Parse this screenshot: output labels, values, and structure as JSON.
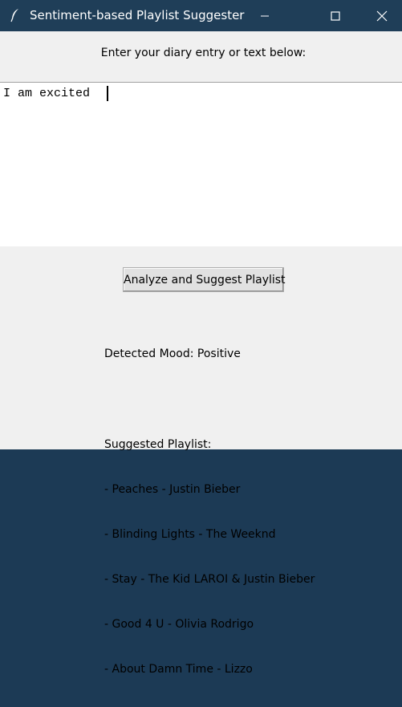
{
  "window": {
    "title": "Sentiment-based Playlist Suggester",
    "icon": "feather-icon"
  },
  "colors": {
    "titlebar_bg": "#1f3e58",
    "window_bg": "#f0f0f0",
    "text_area_bg": "#ffffff"
  },
  "prompt": {
    "label": "Enter your diary entry or text below:"
  },
  "text_area": {
    "value": "I am excited "
  },
  "actions": {
    "analyze_label": "Analyze and Suggest Playlist"
  },
  "result": {
    "mood_text": "Detected Mood: Positive",
    "playlist_heading": "Suggested Playlist:",
    "songs": [
      "- Peaches - Justin Bieber",
      "- Blinding Lights - The Weeknd",
      "- Stay - The Kid LAROI & Justin Bieber",
      "- Good 4 U - Olivia Rodrigo",
      "- About Damn Time - Lizzo"
    ]
  }
}
